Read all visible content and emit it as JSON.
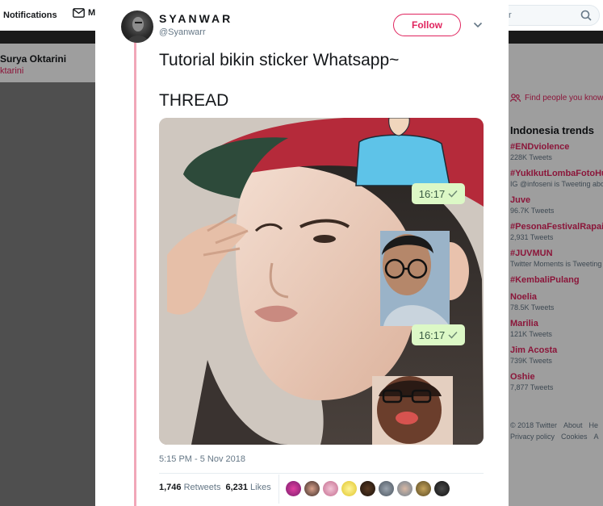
{
  "background": {
    "nav": {
      "notifications_label": "Notifications",
      "messages_label": "M",
      "search_placeholder": "r"
    },
    "profile": {
      "name": "Surya Oktarini",
      "handle": "ktarini"
    },
    "sidebar": {
      "find_people": "Find people you know",
      "trends_title": "Indonesia trends",
      "trends": [
        {
          "name": "#ENDviolence",
          "meta": "228K Tweets"
        },
        {
          "name": "#YukIkutLombaFotoHut",
          "meta": "IG @infoseni is Tweeting about"
        },
        {
          "name": "Juve",
          "meta": "96.7K Tweets"
        },
        {
          "name": "#PesonaFestivalRapaiA",
          "meta": "2,931 Tweets"
        },
        {
          "name": "#JUVMUN",
          "meta": "Twitter Moments is Tweeting"
        },
        {
          "name": "#KembaliPulang",
          "meta": ""
        },
        {
          "name": "Noelia",
          "meta": "78.5K Tweets"
        },
        {
          "name": "Marilia",
          "meta": "121K Tweets"
        },
        {
          "name": "Jim Acosta",
          "meta": "739K Tweets"
        },
        {
          "name": "Oshie",
          "meta": "7,877 Tweets"
        }
      ],
      "footer": {
        "copyright": "© 2018 Twitter",
        "about": "About",
        "help": "He",
        "privacy": "Privacy policy",
        "cookies": "Cookies",
        "ads": "A"
      }
    }
  },
  "tweet": {
    "author": {
      "display_name": "SYANWAR",
      "handle": "@Syanwarr"
    },
    "follow_label": "Follow",
    "text_line1": "Tutorial bikin sticker Whatsapp~",
    "text_line2": "THREAD",
    "media": {
      "bubble1_time": "16:17",
      "bubble2_time": "16:17"
    },
    "timestamp": "5:15 PM - 5 Nov 2018",
    "retweets_count": "1,746",
    "retweets_label": "Retweets",
    "likes_count": "6,231",
    "likes_label": "Likes"
  },
  "colors": {
    "accent": "#e0245e",
    "thread_line": "#f1a7b8",
    "whatsapp_bubble": "#dcf8c6"
  }
}
